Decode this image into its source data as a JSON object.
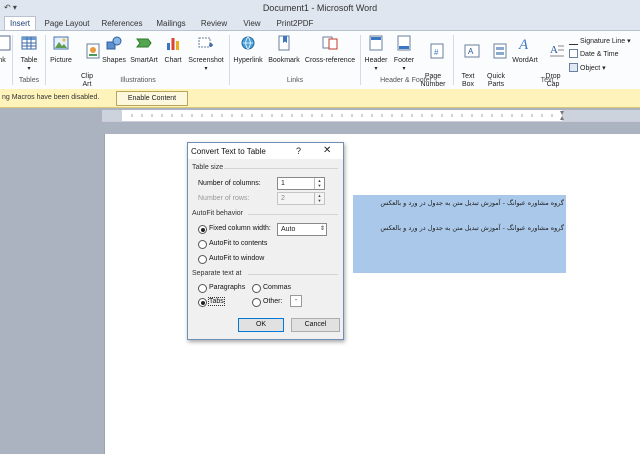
{
  "window": {
    "title": "Document1 - Microsoft Word",
    "quick_access": "↶  ▾"
  },
  "tabs": [
    {
      "label": "Insert",
      "active": true
    },
    {
      "label": "Page Layout"
    },
    {
      "label": "References"
    },
    {
      "label": "Mailings"
    },
    {
      "label": "Review"
    },
    {
      "label": "View"
    },
    {
      "label": "Print2PDF"
    }
  ],
  "ribbon": {
    "pages_partial": {
      "label": "nk"
    },
    "tables": {
      "table_label": "Table",
      "group": "Tables"
    },
    "illustrations": {
      "picture": "Picture",
      "clipart": "Clip\nArt",
      "shapes": "Shapes",
      "smartart": "SmartArt",
      "chart": "Chart",
      "screenshot": "Screenshot",
      "group": "Illustrations"
    },
    "links": {
      "hyperlink": "Hyperlink",
      "bookmark": "Bookmark",
      "crossref": "Cross-reference",
      "group": "Links"
    },
    "header_footer": {
      "header": "Header",
      "footer": "Footer",
      "page_number": "Page\nNumber",
      "group": "Header & Footer"
    },
    "text": {
      "textbox": "Text\nBox",
      "quickparts": "Quick\nParts",
      "wordart": "WordArt",
      "dropcap": "Drop\nCap",
      "signature_line": "Signature Line",
      "date_time": "Date & Time",
      "object": "Object",
      "group": "Text"
    }
  },
  "message_bar": {
    "text": "ng   Macros have been disabled.",
    "button": "Enable Content"
  },
  "document": {
    "lines": [
      "گروه مشاوره عبوانگ - آموزش تبدیل متن به جدول در ورد و بالعکس",
      "گروه مشاوره عبوانگ - آموزش تبدیل متن به جدول در ورد و بالعکس"
    ]
  },
  "dialog": {
    "title": "Convert Text to Table",
    "help": "?",
    "close": "✕",
    "table_size": {
      "header": "Table size",
      "columns_label": "Number of columns:",
      "columns_value": "1",
      "rows_label": "Number of rows:",
      "rows_value": "2"
    },
    "autofit": {
      "header": "AutoFit behavior",
      "fixed": "Fixed column width:",
      "fixed_value": "Auto",
      "contents": "AutoFit to contents",
      "window": "AutoFit to window",
      "selected": "fixed"
    },
    "separate": {
      "header": "Separate text at",
      "paragraphs": "Paragraphs",
      "commas": "Commas",
      "tabs": "Tabs",
      "other": "Other:",
      "other_value": "-",
      "selected": "tabs"
    },
    "ok": "OK",
    "cancel": "Cancel"
  },
  "colors": {
    "accent": "#2b579a",
    "selection": "#a9c8ea",
    "message_bar": "#fdf3bb"
  }
}
